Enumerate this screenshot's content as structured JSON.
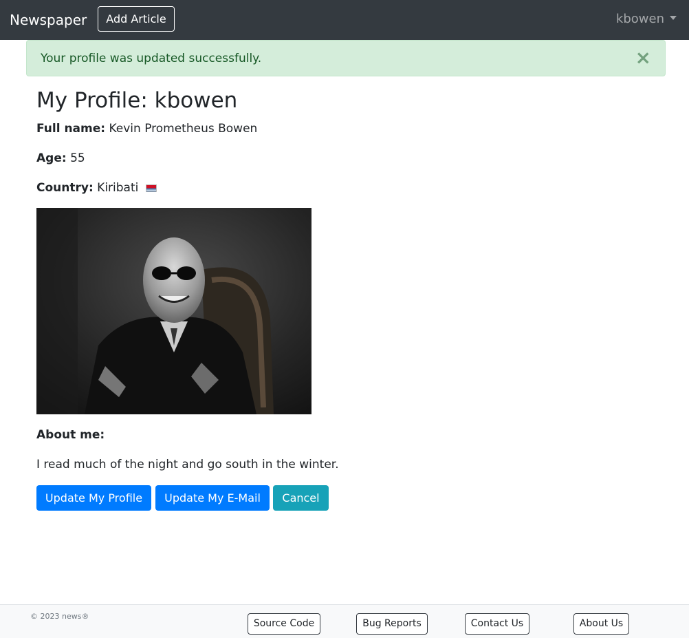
{
  "navbar": {
    "brand": "Newspaper",
    "add_article_label": "Add Article",
    "username": "kbowen"
  },
  "alert": {
    "message": "Your profile was updated successfully.",
    "close_symbol": "×"
  },
  "profile": {
    "title": "My Profile: kbowen",
    "full_name_label": "Full name:",
    "full_name": "Kevin Prometheus Bowen",
    "age_label": "Age:",
    "age": "55",
    "country_label": "Country:",
    "country": "Kiribati",
    "flag_icon": "kiribati-flag-icon",
    "about_label": "About me:",
    "about_text": "I read much of the night and go south in the winter."
  },
  "actions": {
    "update_profile": "Update My Profile",
    "update_email": "Update My E-Mail",
    "cancel": "Cancel"
  },
  "footer": {
    "copyright": "© 2023 news®",
    "links": [
      "Source Code",
      "Bug Reports",
      "Contact Us",
      "About Us"
    ]
  },
  "colors": {
    "navbar_bg": "#343a40",
    "alert_bg": "#d4edda",
    "alert_text": "#155724",
    "primary": "#007bff",
    "info": "#17a2b8"
  }
}
